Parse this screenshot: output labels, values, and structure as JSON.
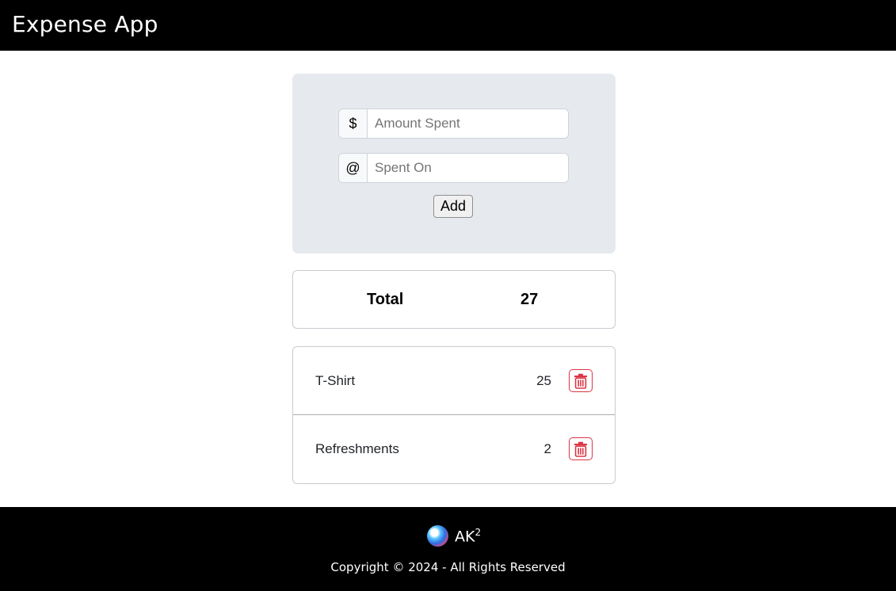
{
  "header": {
    "title": "Expense App"
  },
  "form": {
    "amount_addon": "$",
    "amount_placeholder": "Amount Spent",
    "spent_on_addon": "@",
    "spent_on_placeholder": "Spent On",
    "add_label": "Add"
  },
  "total": {
    "label": "Total",
    "value": "27"
  },
  "expenses": [
    {
      "name": "T-Shirt",
      "amount": "25"
    },
    {
      "name": "Refreshments",
      "amount": "2"
    }
  ],
  "footer": {
    "initials": "AK",
    "superscript": "2",
    "copyright": "Copyright © 2024 - All Rights Reserved"
  },
  "colors": {
    "delete": "#dc3545",
    "header_bg": "#000000",
    "form_bg": "#e6e9ee"
  },
  "icons": {
    "delete": "trash-icon"
  }
}
